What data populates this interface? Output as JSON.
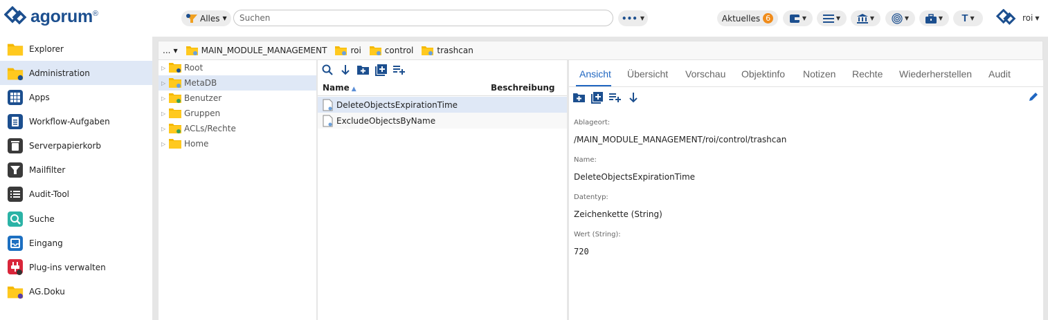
{
  "app": {
    "logo_text": "agorum",
    "logo_reg": "®"
  },
  "topbar": {
    "filter_label": "Alles",
    "search_placeholder": "Suchen",
    "more_label": "•••",
    "aktuelles_label": "Aktuelles",
    "aktuelles_count": "6",
    "user_label": "roi"
  },
  "nav": {
    "items": [
      {
        "label": "Explorer",
        "icon": "folder-icon"
      },
      {
        "label": "Administration",
        "icon": "folder-gear-icon"
      },
      {
        "label": "Apps",
        "icon": "apps-grid-icon"
      },
      {
        "label": "Workflow-Aufgaben",
        "icon": "clipboard-icon"
      },
      {
        "label": "Serverpapierkorb",
        "icon": "trash-icon"
      },
      {
        "label": "Mailfilter",
        "icon": "filter-icon"
      },
      {
        "label": "Audit-Tool",
        "icon": "list-icon"
      },
      {
        "label": "Suche",
        "icon": "search-icon"
      },
      {
        "label": "Eingang",
        "icon": "inbox-icon"
      },
      {
        "label": "Plug-ins verwalten",
        "icon": "plugin-icon"
      },
      {
        "label": "AG.Doku",
        "icon": "folder-doc-icon"
      }
    ],
    "active_index": 1
  },
  "breadcrumb": {
    "dots": "...",
    "items": [
      "MAIN_MODULE_MANAGEMENT",
      "roi",
      "control",
      "trashcan"
    ]
  },
  "tree": {
    "items": [
      "Root",
      "MetaDB",
      "Benutzer",
      "Gruppen",
      "ACLs/Rechte",
      "Home"
    ],
    "selected_index": 1
  },
  "list": {
    "columns": {
      "name": "Name",
      "description": "Beschreibung"
    },
    "rows": [
      "DeleteObjectsExpirationTime",
      "ExcludeObjectsByName"
    ],
    "selected_index": 0
  },
  "detail": {
    "tabs": [
      "Ansicht",
      "Übersicht",
      "Vorschau",
      "Objektinfo",
      "Notizen",
      "Rechte",
      "Wiederherstellen",
      "Audit"
    ],
    "active_tab": 0,
    "fields": [
      {
        "label": "Ablageort:",
        "value": "/MAIN_MODULE_MANAGEMENT/roi/control/trashcan"
      },
      {
        "label": "Name:",
        "value": "DeleteObjectsExpirationTime"
      },
      {
        "label": "Datentyp:",
        "value": "Zeichenkette (String)"
      },
      {
        "label": "Wert (String):",
        "value": "720"
      }
    ]
  },
  "colors": {
    "brand": "#1c4f8f",
    "accent": "#1f66c1",
    "selection": "#dfe8f6",
    "folder": "#f5b800",
    "badge": "#f08c1c"
  }
}
